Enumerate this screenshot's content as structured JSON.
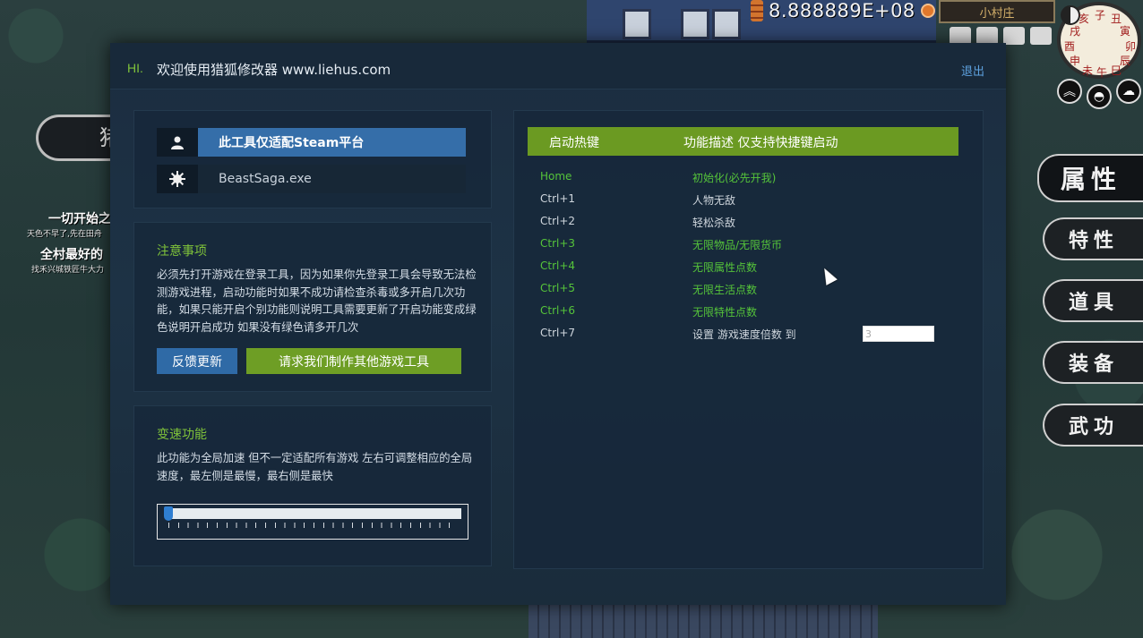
{
  "game": {
    "currency_value": "8.888889E+08",
    "location": "小村庄",
    "compass_branches": [
      "亥",
      "子",
      "丑",
      "戌",
      "寅",
      "酉",
      "卯",
      "申",
      "辰",
      "未",
      "午",
      "巳"
    ],
    "side_menu": [
      "属性",
      "特性",
      "道具",
      "装备",
      "武功"
    ],
    "left_banner": "猪",
    "quests": [
      {
        "title": "一切开始之",
        "sub": "天色不早了,先在田舟"
      },
      {
        "title": "全村最好的",
        "sub": "找禾兴城铁匠牛大力"
      }
    ]
  },
  "trainer": {
    "hi": "HI.",
    "welcome": "欢迎使用猎狐修改器 www.liehus.com",
    "exit_label": "退出",
    "platform": {
      "steam_label": "此工具仅适配Steam平台",
      "exe_name": "BeastSaga.exe",
      "user_icon": "user-icon",
      "gear_icon": "gear-icon"
    },
    "notice": {
      "title": "注意事项",
      "text": "必须先打开游戏在登录工具，因为如果你先登录工具会导致无法检测游戏进程，启动功能时如果不成功请检查杀毒或多开启几次功能，如果只能开启个别功能则说明工具需要更新了开启功能变成绿色说明开启成功 如果没有绿色请多开几次",
      "feedback_button": "反馈更新",
      "request_button": "请求我们制作其他游戏工具"
    },
    "speed": {
      "title": "变速功能",
      "text": "此功能为全局加速 但不一定适配所有游戏 左右可调整相应的全局速度，最左侧是最慢，最右侧是最快",
      "slider_value": 0
    },
    "hotkeys": {
      "header_key": "启动热键",
      "header_desc": "功能描述 仅支持快捷键启动",
      "rows": [
        {
          "key": "Home",
          "desc": "初始化(必先开我)",
          "active": true
        },
        {
          "key": "Ctrl+1",
          "desc": "人物无敌",
          "active": false
        },
        {
          "key": "Ctrl+2",
          "desc": "轻松杀敌",
          "active": false
        },
        {
          "key": "Ctrl+3",
          "desc": "无限物品/无限货币",
          "active": true
        },
        {
          "key": "Ctrl+4",
          "desc": "无限属性点数",
          "active": true
        },
        {
          "key": "Ctrl+5",
          "desc": "无限生活点数",
          "active": true
        },
        {
          "key": "Ctrl+6",
          "desc": "无限特性点数",
          "active": true
        },
        {
          "key": "Ctrl+7",
          "desc": "设置 游戏速度倍数 到",
          "active": false,
          "input_value": "3"
        }
      ]
    },
    "colors": {
      "accent_green": "#6b9a22",
      "active_text": "#55c43a",
      "blue_button": "#2f6aa6",
      "link_blue": "#5ea2e0"
    }
  }
}
